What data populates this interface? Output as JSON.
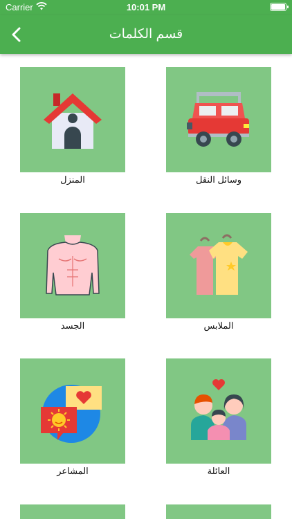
{
  "status": {
    "carrier": "Carrier",
    "time": "10:01 PM"
  },
  "nav": {
    "title": "قسم الكلمات",
    "back_icon": "chevron-left-icon"
  },
  "colors": {
    "primary": "#4caf50",
    "card": "#81c784"
  },
  "categories": [
    {
      "label": "وسائل النقل",
      "icon": "car-icon"
    },
    {
      "label": "المنزل",
      "icon": "house-icon"
    },
    {
      "label": "الملابس",
      "icon": "clothes-icon"
    },
    {
      "label": "الجسد",
      "icon": "body-icon"
    },
    {
      "label": "العائلة",
      "icon": "family-icon"
    },
    {
      "label": "المشاعر",
      "icon": "feelings-icon"
    }
  ]
}
